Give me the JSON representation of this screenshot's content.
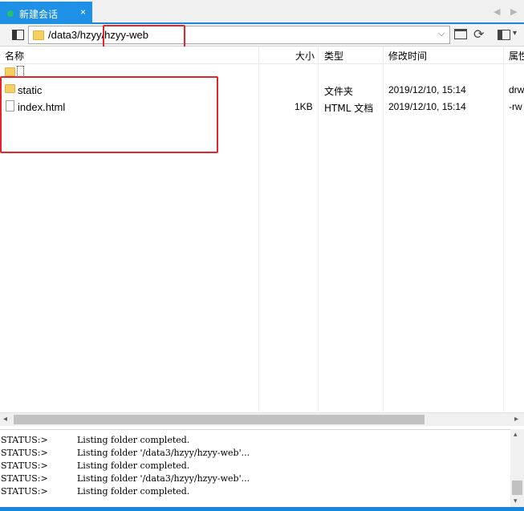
{
  "tab": {
    "title": "新建会话",
    "close_glyph": "×",
    "status_color": "#23c26b"
  },
  "path": {
    "value": "/data3/hzyy/hzyy-web"
  },
  "columns": {
    "name": "名称",
    "size": "大小",
    "type": "类型",
    "modified": "修改时间",
    "attributes": "属性"
  },
  "files": [
    {
      "name": "",
      "icon": "folder-icon",
      "size": "",
      "type": "",
      "modified": "",
      "attributes": ""
    },
    {
      "name": "static",
      "icon": "folder-icon",
      "size": "",
      "type": "文件夹",
      "modified": "2019/12/10, 15:14",
      "attributes": "drw"
    },
    {
      "name": "index.html",
      "icon": "file-icon",
      "size": "1KB",
      "type": "HTML 文档",
      "modified": "2019/12/10, 15:14",
      "attributes": "-rw"
    }
  ],
  "log": [
    {
      "status": "STATUS:>",
      "message": "Listing folder completed."
    },
    {
      "status": "STATUS:>",
      "message": "Listing folder '/data3/hzyy/hzyy-web'..."
    },
    {
      "status": "STATUS:>",
      "message": "Listing folder completed."
    },
    {
      "status": "STATUS:>",
      "message": "Listing folder '/data3/hzyy/hzyy-web'..."
    },
    {
      "status": "STATUS:>",
      "message": "Listing folder completed."
    }
  ],
  "colors": {
    "accent": "#1e90e6",
    "highlight": "#e4252a",
    "folder": "#f5cf60"
  }
}
